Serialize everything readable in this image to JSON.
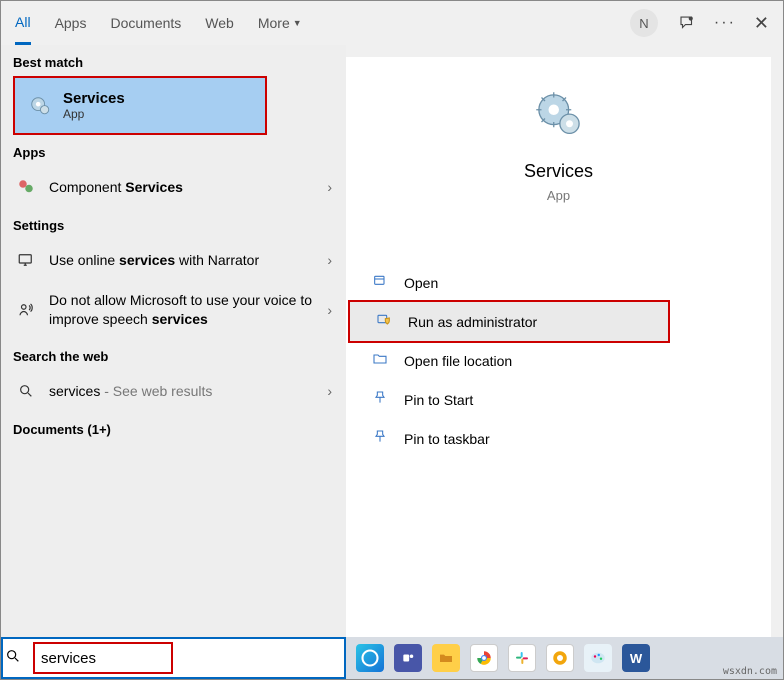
{
  "tabs": {
    "all": "All",
    "apps": "Apps",
    "documents": "Documents",
    "web": "Web",
    "more": "More"
  },
  "user_initial": "N",
  "sections": {
    "best_match": "Best match",
    "apps": "Apps",
    "settings": "Settings",
    "search_web": "Search the web",
    "documents": "Documents (1+)"
  },
  "best": {
    "title": "Services",
    "subtitle": "App"
  },
  "apps_row": {
    "prefix": "Component ",
    "bold": "Services"
  },
  "settings_rows": {
    "r1_pre": "Use online ",
    "r1_bold": "services",
    "r1_post": " with Narrator",
    "r2_pre": "Do not allow Microsoft to use your voice to improve speech ",
    "r2_bold": "services"
  },
  "web_row": {
    "term": "services",
    "suffix": " - See web results"
  },
  "hero": {
    "title": "Services",
    "subtitle": "App"
  },
  "actions": {
    "open": "Open",
    "run_admin": "Run as administrator",
    "open_loc": "Open file location",
    "pin_start": "Pin to Start",
    "pin_taskbar": "Pin to taskbar"
  },
  "search_value": "services",
  "watermark": "wsxdn.com"
}
